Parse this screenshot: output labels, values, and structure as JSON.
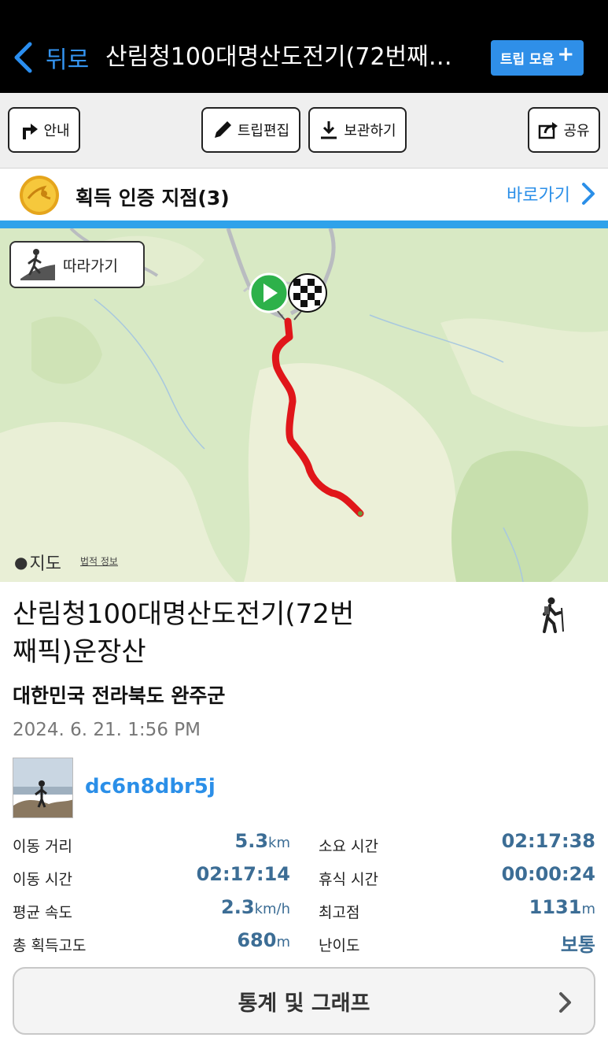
{
  "header": {
    "back_label": "뒤로",
    "title": "산림청100대명산도전기(72번째…",
    "trip_button": "트립 모음",
    "trip_plus": "+"
  },
  "toolbar": {
    "guide": "안내",
    "edit": "트립편집",
    "save": "보관하기",
    "share": "공유"
  },
  "certification": {
    "label": "획득 인증 지점(3)",
    "go_label": "바로가기"
  },
  "map": {
    "follow_label": "따라가기",
    "logo_label": "지도",
    "legal_label": "법적 정보",
    "route_color": "#e0161a"
  },
  "trip": {
    "title": "산림청100대명산도전기(72번째픽)운장산",
    "region": "대한민국 전라북도 완주군",
    "date": "2024. 6. 21. 1:56 PM",
    "username": "dc6n8dbr5j"
  },
  "stats": [
    {
      "label": "이동 거리",
      "value": "5.3",
      "unit": "km"
    },
    {
      "label": "소요 시간",
      "value": "02:17:38",
      "unit": ""
    },
    {
      "label": "이동 시간",
      "value": "02:17:14",
      "unit": ""
    },
    {
      "label": "휴식 시간",
      "value": "00:00:24",
      "unit": ""
    },
    {
      "label": "평균 속도",
      "value": "2.3",
      "unit": "km/h"
    },
    {
      "label": "최고점",
      "value": "1131",
      "unit": "m"
    },
    {
      "label": "총 획득고도",
      "value": "680",
      "unit": "m"
    },
    {
      "label": "난이도",
      "value": "보통",
      "unit": ""
    }
  ],
  "graph_button": "통계 및 그래프",
  "icons": {
    "back": "chevron-left-icon",
    "guide": "turn-arrow-icon",
    "edit": "pencil-icon",
    "save": "download-icon",
    "share": "share-icon",
    "badge": "medal-icon",
    "follow": "hiker-icon"
  },
  "colors": {
    "accent": "#2b8fe8",
    "stat_value": "#3c6d95",
    "header_bg": "#000000"
  }
}
